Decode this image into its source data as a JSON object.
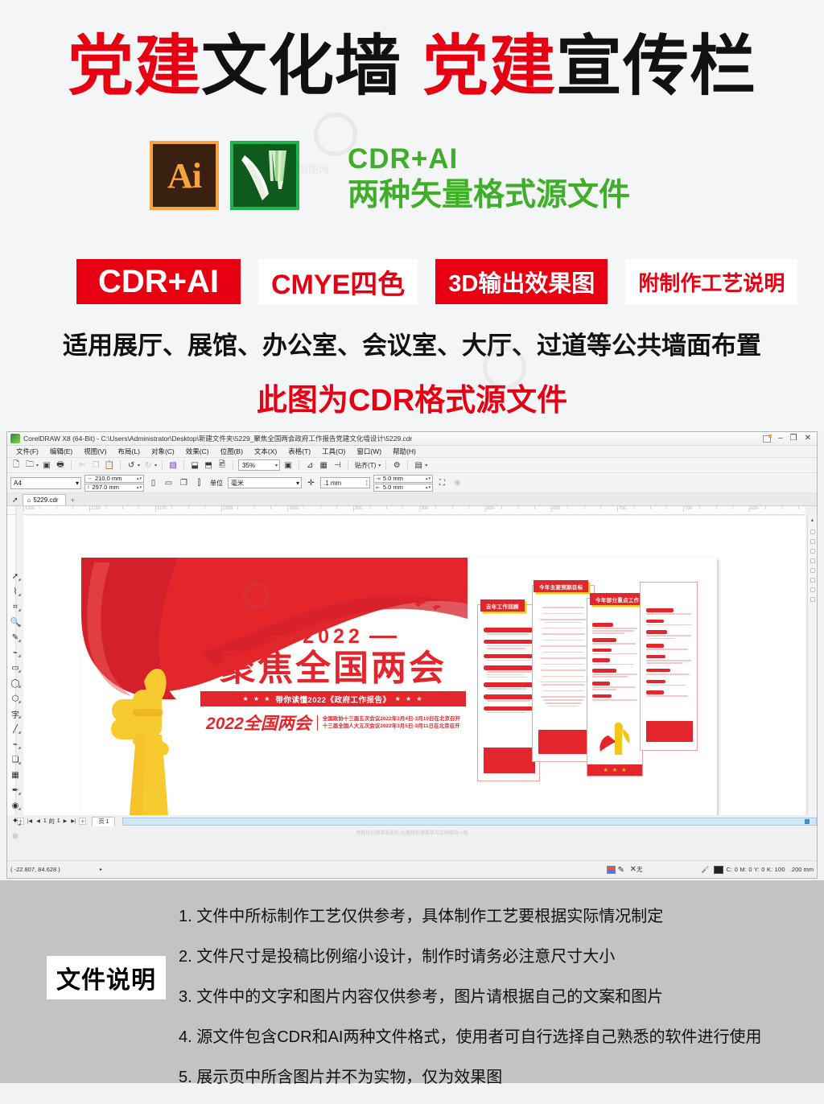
{
  "promo": {
    "title_parts": [
      {
        "text": "党建",
        "color": "red"
      },
      {
        "text": "文化墙",
        "color": "black"
      },
      {
        "text": "党建",
        "color": "red"
      },
      {
        "text": "宣传栏",
        "color": "black"
      }
    ],
    "icons": {
      "ai_glyph": "Ai",
      "ai_name": "adobe-illustrator-icon",
      "cdr_name": "coreldraw-icon"
    },
    "caption_line1": "CDR+AI",
    "caption_line2": "两种矢量格式源文件",
    "badges": [
      {
        "label": "CDR+AI",
        "style": "fill"
      },
      {
        "label": "CMYE四色",
        "style": "ghost"
      },
      {
        "label": "3D输出效果图",
        "style": "fill"
      },
      {
        "label": "附制作工艺说明",
        "style": "ghost"
      }
    ],
    "line1": "适用展厅、展馆、办公室、会议室、大厅、过道等公共墙面布置",
    "line2": "此图为CDR格式源文件",
    "colors": {
      "red": "#e60012",
      "green": "#3fae29",
      "black": "#111111"
    }
  },
  "coreldraw": {
    "title": "CorelDRAW X8 (64-Bit) - C:\\Users\\Administrator\\Desktop\\新建文件夹\\5229_聚焦全国两会政府工作报告党建文化墙设计\\5229.cdr",
    "window_buttons": [
      "restore-down",
      "–",
      "❐",
      "✕"
    ],
    "menus": [
      "文件(F)",
      "编辑(E)",
      "视图(V)",
      "布局(L)",
      "对象(C)",
      "效果(C)",
      "位图(B)",
      "文本(X)",
      "表格(T)",
      "工具(O)",
      "窗口(W)",
      "帮助(H)"
    ],
    "toolbar": {
      "zoom_value": "35%",
      "snap_label": "贴齐(T)",
      "icons": [
        "new-document-icon",
        "open-folder-icon",
        "save-icon",
        "print-icon",
        "cut-icon",
        "copy-icon",
        "paste-icon",
        "undo-icon",
        "redo-icon",
        "import-icon",
        "export-icon",
        "publish-pdf-icon",
        "zoom-level-combo",
        "fullscreen-preview-icon",
        "launch-icon",
        "grid-icon",
        "align-icon",
        "options-gear-icon",
        "view-mode-icon"
      ]
    },
    "propertybar": {
      "page_preset": "A4",
      "page_width": "210.0 mm",
      "page_height": "297.0 mm",
      "unit_label": "单位",
      "unit_value": "毫米",
      "nudge_value": ".1 mm",
      "duplicate_x": "5.0 mm",
      "duplicate_y": "5.0 mm",
      "orientation_portrait": "portrait-icon",
      "orientation_landscape": "landscape-icon"
    },
    "document_tab": "5229.cdr",
    "new_tab_label": "+",
    "toolbox": [
      {
        "name": "pick-tool-icon",
        "glyph": "➚"
      },
      {
        "name": "shape-tool-icon",
        "glyph": "⌇"
      },
      {
        "name": "crop-tool-icon",
        "glyph": "⌗"
      },
      {
        "name": "zoom-tool-icon",
        "glyph": "🔍"
      },
      {
        "name": "freehand-tool-icon",
        "glyph": "✎"
      },
      {
        "name": "smart-fill-tool-icon",
        "glyph": "⌁"
      },
      {
        "name": "rectangle-tool-icon",
        "glyph": "▭"
      },
      {
        "name": "ellipse-tool-icon",
        "glyph": "◯"
      },
      {
        "name": "polygon-tool-icon",
        "glyph": "⬡"
      },
      {
        "name": "text-tool-icon",
        "glyph": "字"
      },
      {
        "name": "parallel-dimension-tool-icon",
        "glyph": "╱"
      },
      {
        "name": "straight-line-connector-icon",
        "glyph": "⌁"
      },
      {
        "name": "drop-shadow-tool-icon",
        "glyph": "❏"
      },
      {
        "name": "transparency-tool-icon",
        "glyph": "▦"
      },
      {
        "name": "color-eyedropper-tool-icon",
        "glyph": "✒"
      },
      {
        "name": "interactive-fill-tool-icon",
        "glyph": "◉"
      },
      {
        "name": "smart-drawing-tool-icon",
        "glyph": "✦"
      },
      {
        "name": "outline-tool-icon",
        "glyph": "⊕"
      }
    ],
    "ruler_ticks": [
      "1200",
      "1150",
      "1100",
      "1050",
      "1000",
      "950",
      "900",
      "850",
      "800",
      "750",
      "700",
      "650"
    ],
    "page_nav": {
      "current": "1",
      "of_label": "的",
      "total": "1",
      "page_tab": "页 1"
    },
    "hint": "用鼠标右键单击此处,以便将右键菜单与文档保持一致",
    "status": {
      "coords": "( -22.807, 84.628 )",
      "outline_label": "无",
      "fill_cmyk": "C: 0 M: 0 Y: 0 K: 100",
      "outline_width": ".200 mm"
    }
  },
  "poster": {
    "year": "2022",
    "headline": "聚焦全国两会",
    "banner": "带你读懂2022《政府工作报告》",
    "banner_stars": "★ ★ ★",
    "foot_big": "2022全国两会",
    "foot_line1": "全国政协十三届五次会议2022年3月4日-3月10日在北京召开",
    "foot_line2": "十三届全国人大五次会议2022年3月5日-3月11日在北京召开",
    "colors": {
      "red": "#e3262c",
      "yellow": "#f5c518"
    },
    "panels": [
      {
        "header": "去年工作回顾"
      },
      {
        "header": "今年主要预期目标"
      },
      {
        "header": "今年部分重点工作"
      },
      {
        "header": ""
      }
    ]
  },
  "notes": {
    "label": "文件说明",
    "items": [
      "1. 文件中所标制作工艺仅供参考，具体制作工艺要根据实际情况制定",
      "2. 文件尺寸是投稿比例缩小设计，制作时请务必注意尺寸大小",
      "3. 文件中的文字和图片内容仅供参考，图片请根据自己的文案和图片",
      "4. 源文件包含CDR和AI两种文件格式，使用者可自行选择自己熟悉的软件进行使用",
      "5. 展示页中所含图片并不为实物，仅为效果图"
    ]
  }
}
